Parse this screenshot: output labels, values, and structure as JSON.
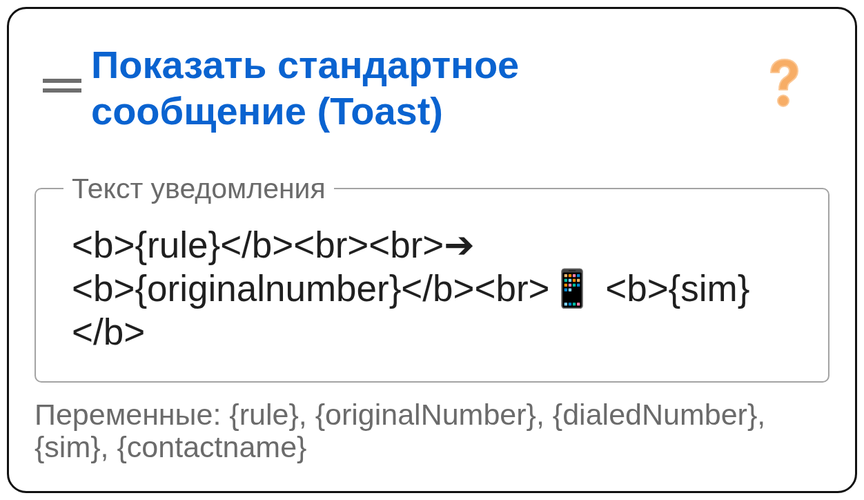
{
  "header": {
    "title": "Показать стандартное сообщение (Toast)"
  },
  "notification_field": {
    "label": "Текст уведомления",
    "value_lines": [
      "<b>{rule}</b><br><br>➔",
      "<b>{originalnumber}</b><br>📱 <b>{sim}",
      "</b>"
    ]
  },
  "helper_text": "Переменные: {rule}, {originalNumber}, {dialedNumber}, {sim}, {contactname}"
}
